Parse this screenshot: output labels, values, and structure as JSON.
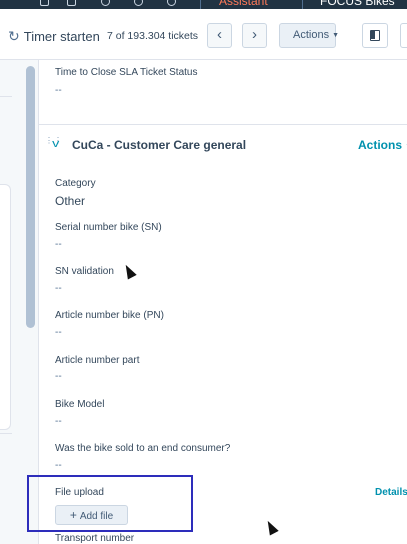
{
  "topbar": {
    "assistant_label": "Assistant",
    "account_label": "FOCUS Bikes"
  },
  "toolbar": {
    "timer_label": "Timer starten",
    "ticket_counter": "7 of 193.304 tickets",
    "prev_icon": "‹",
    "next_icon": "›",
    "actions_label": "Actions"
  },
  "fields_above": [
    {
      "label": "Time to Close SLA Ticket Status",
      "value": "--"
    }
  ],
  "section": {
    "title": "CuCa - Customer Care general",
    "actions_label": "Actions",
    "fields": [
      {
        "label": "Category",
        "value": "Other"
      },
      {
        "label": "Serial number bike (SN)",
        "value": "--"
      },
      {
        "label": "SN validation",
        "value": "--"
      },
      {
        "label": "Article number bike (PN)",
        "value": "--"
      },
      {
        "label": "Article number part",
        "value": "--"
      },
      {
        "label": "Bike Model",
        "value": "--"
      },
      {
        "label": "Was the bike sold to an end consumer?",
        "value": "--"
      }
    ],
    "file_upload": {
      "label": "File upload",
      "details_label": "Details",
      "add_button": "Add file"
    },
    "next_field_label": "Transport number"
  },
  "colors": {
    "accent": "#0091ae",
    "highlight_box": "#2d2dbb",
    "topbar": "#213343"
  },
  "icons": {
    "timer": "timer-icon",
    "prev": "chevron-left-icon",
    "next": "chevron-right-icon",
    "layout": "sidebar-layout-icon",
    "collapse": "chevron-down-icon",
    "drag": "drag-handle-icon",
    "add": "plus-icon"
  }
}
